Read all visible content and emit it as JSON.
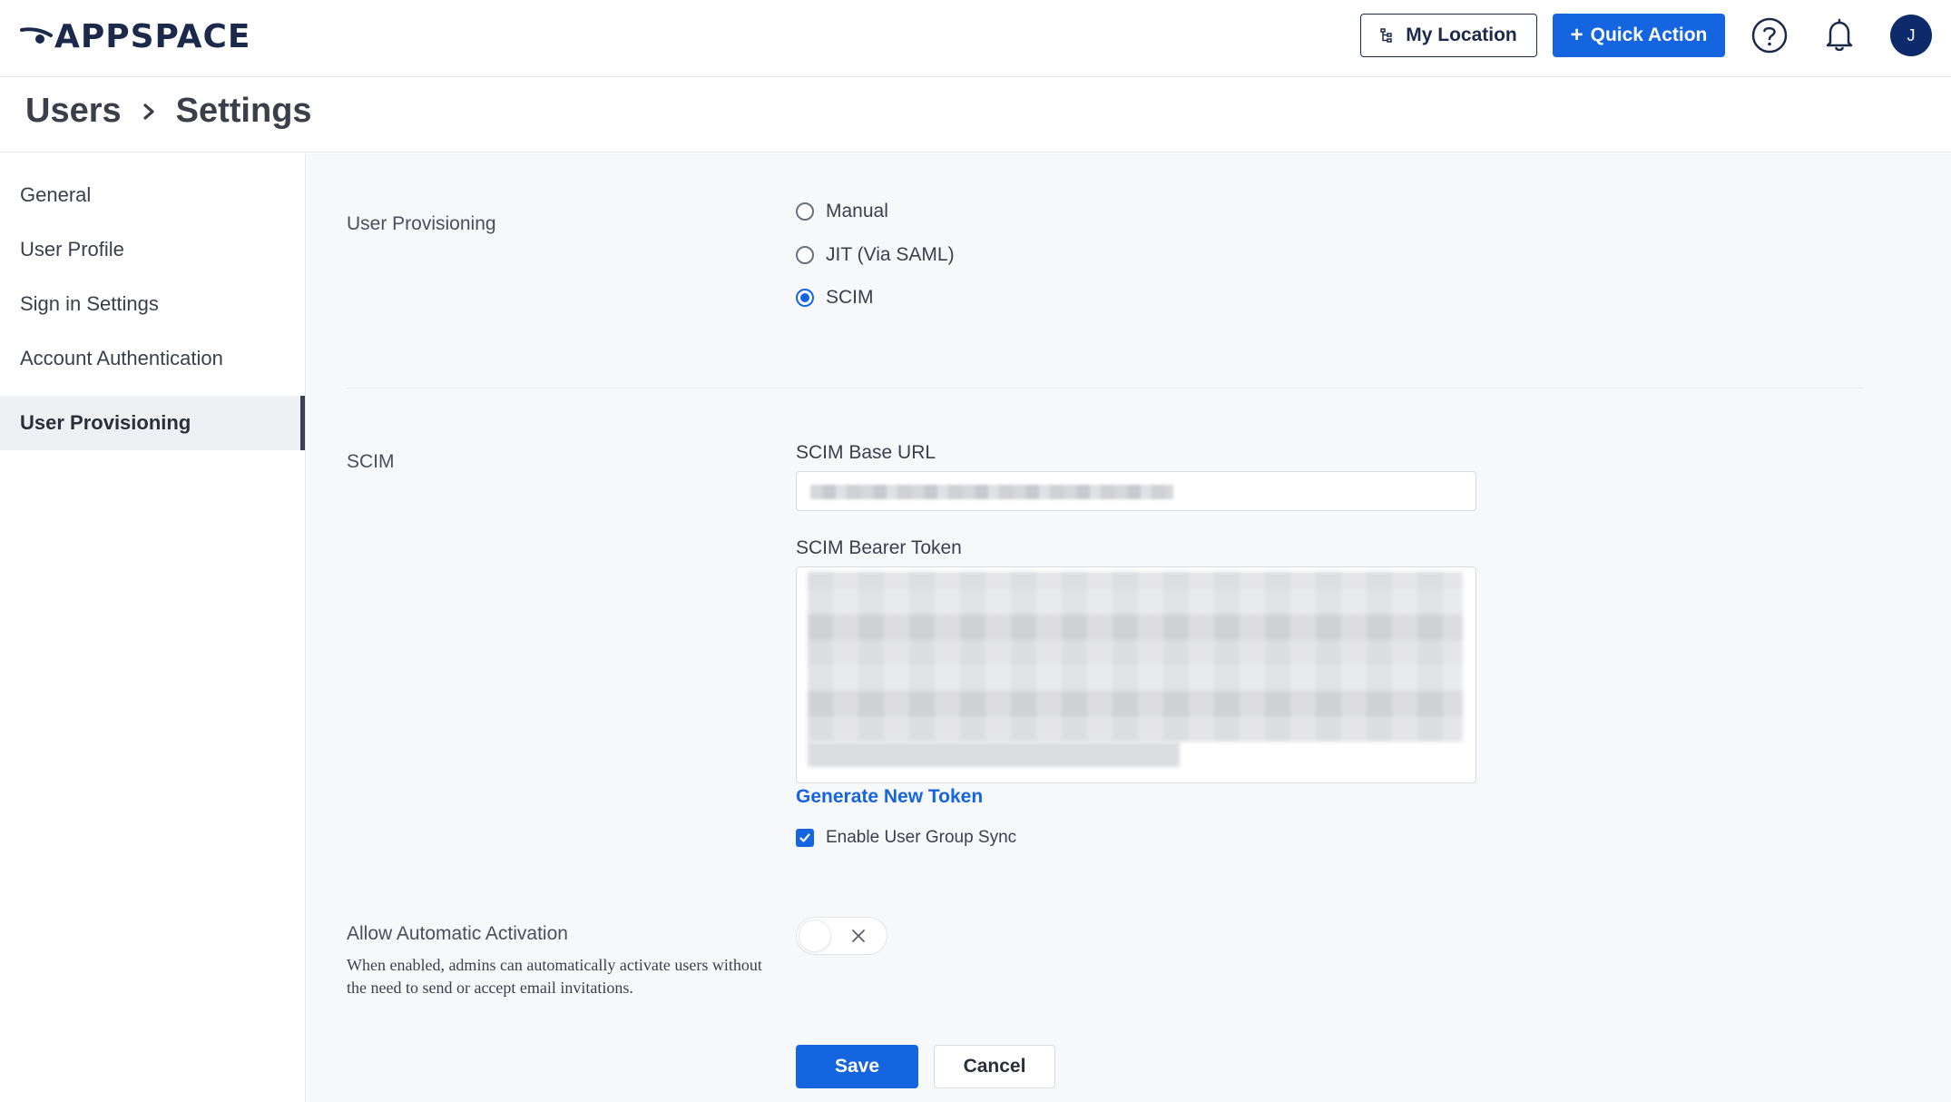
{
  "header": {
    "logo_text": "APPSPACE",
    "my_location_label": "My Location",
    "quick_action_label": "Quick Action",
    "avatar_initial": "J",
    "icons": [
      "location-tree-icon",
      "plus-icon",
      "help-icon",
      "bell-icon"
    ]
  },
  "breadcrumb": {
    "items": [
      "Users",
      "Settings"
    ]
  },
  "sidebar": {
    "items": [
      {
        "label": "General",
        "active": false
      },
      {
        "label": "User Profile",
        "active": false
      },
      {
        "label": "Sign in Settings",
        "active": false
      },
      {
        "label": "Account Authentication",
        "active": false
      },
      {
        "label": "User Provisioning",
        "active": true
      }
    ]
  },
  "main": {
    "provisioning": {
      "label": "User Provisioning",
      "options": [
        {
          "label": "Manual",
          "selected": false
        },
        {
          "label": "JIT (Via SAML)",
          "selected": false
        },
        {
          "label": "SCIM",
          "selected": true
        }
      ]
    },
    "scim": {
      "label": "SCIM",
      "base_url_label": "SCIM Base URL",
      "bearer_token_label": "SCIM Bearer Token",
      "generate_link": "Generate New Token",
      "group_sync_label": "Enable User Group Sync",
      "group_sync_checked": true
    },
    "auto_activation": {
      "title": "Allow Automatic Activation",
      "description": "When enabled, admins can automatically activate users without the need to send or accept email invitations.",
      "enabled": false
    },
    "actions": {
      "save_label": "Save",
      "cancel_label": "Cancel"
    }
  },
  "colors": {
    "primary": "#1565e0",
    "navy": "#0d2a6b",
    "text": "#2b2f3a",
    "background": "#f7f8fa"
  }
}
